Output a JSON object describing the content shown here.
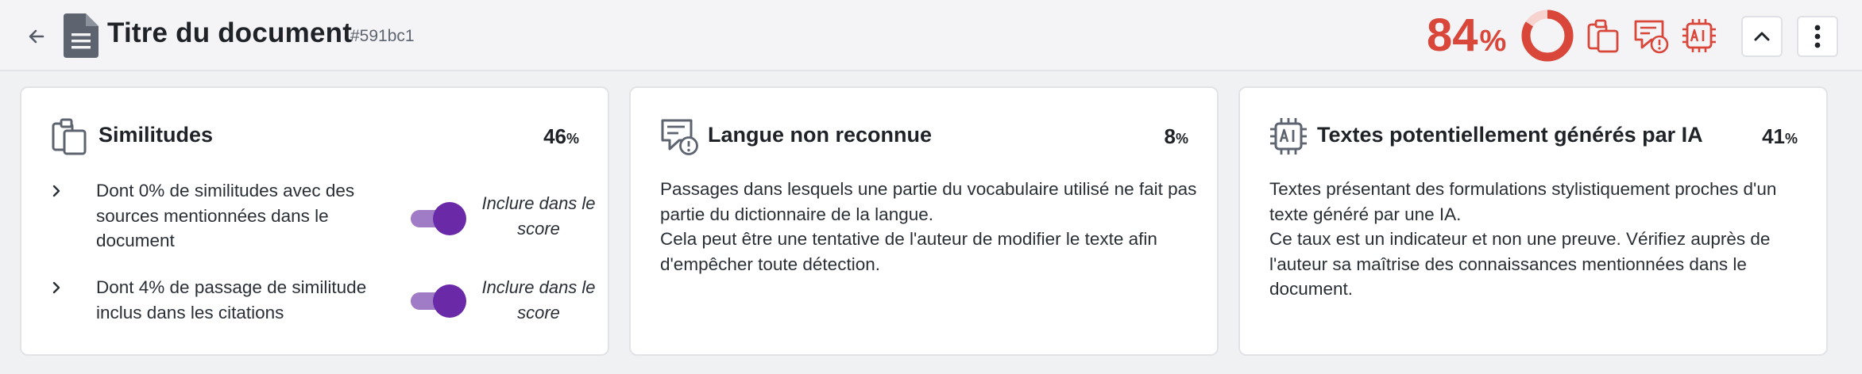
{
  "header": {
    "title": "Titre du document",
    "doc_id": "#591bc1",
    "score_value": "84",
    "score_unit": "%",
    "score_fraction": 0.84,
    "accent_color": "#d9463a"
  },
  "cards": [
    {
      "icon": "clipboard-copy-icon",
      "title": "Similitudes",
      "percent_value": "46",
      "percent_unit": "%",
      "sub_items": [
        {
          "text": "Dont 0% de similitudes avec des sources mentionnées dans le document",
          "toggle_on": true,
          "toggle_label": "Inclure dans le score"
        },
        {
          "text": "Dont 4% de passage de similitude inclus dans les citations",
          "toggle_on": true,
          "toggle_label": "Inclure dans le score"
        }
      ]
    },
    {
      "icon": "message-alert-icon",
      "title": "Langue non reconnue",
      "percent_value": "8",
      "percent_unit": "%",
      "description": [
        "Passages dans lesquels une partie du vocabulaire utilisé ne fait pas partie du dictionnaire de la langue.",
        "Cela peut être une tentative de l'auteur de modifier le texte afin d'empêcher toute détection."
      ]
    },
    {
      "icon": "ai-chip-icon",
      "title": "Textes potentiellement générés par IA",
      "percent_value": "41",
      "percent_unit": "%",
      "description": [
        "Textes présentant des formulations stylistiquement proches d'un texte généré par une IA.",
        "Ce taux est un indicateur et non une preuve. Vérifiez auprès de l'auteur sa maîtrise des connaissances mentionnées dans le document."
      ]
    }
  ]
}
